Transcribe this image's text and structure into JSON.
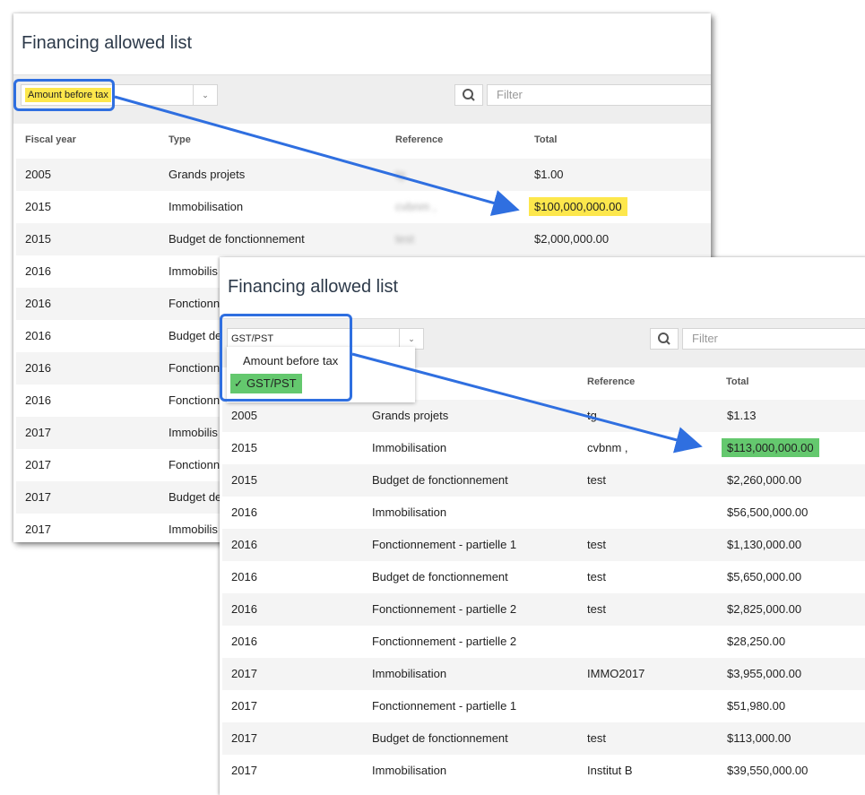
{
  "panel1": {
    "title": "Financing allowed list",
    "select_value": "Amount before tax",
    "filter_placeholder": "Filter",
    "headers": {
      "year": "Fiscal year",
      "type": "Type",
      "reference": "Reference",
      "total": "Total"
    },
    "rows": [
      {
        "year": "2005",
        "type": "Grands projets",
        "reference": "tg",
        "total": "$1.00"
      },
      {
        "year": "2015",
        "type": "Immobilisation",
        "reference": "cvbnm ,",
        "total": "$100,000,000.00"
      },
      {
        "year": "2015",
        "type": "Budget de fonctionnement",
        "reference": "test",
        "total": "$2,000,000.00"
      },
      {
        "year": "2016",
        "type": "Immobilis",
        "reference": "",
        "total": ""
      },
      {
        "year": "2016",
        "type": "Fonctionnem",
        "reference": "",
        "total": ""
      },
      {
        "year": "2016",
        "type": "Budget de",
        "reference": "",
        "total": ""
      },
      {
        "year": "2016",
        "type": "Fonctionnem",
        "reference": "",
        "total": ""
      },
      {
        "year": "2016",
        "type": "Fonctionnem",
        "reference": "",
        "total": ""
      },
      {
        "year": "2017",
        "type": "Immobilis",
        "reference": "",
        "total": ""
      },
      {
        "year": "2017",
        "type": "Fonctionnem",
        "reference": "",
        "total": ""
      },
      {
        "year": "2017",
        "type": "Budget de",
        "reference": "",
        "total": ""
      },
      {
        "year": "2017",
        "type": "Immobilis",
        "reference": "",
        "total": ""
      }
    ]
  },
  "panel2": {
    "title": "Financing allowed list",
    "select_value": "GST/PST",
    "filter_placeholder": "Filter",
    "dropdown_options": [
      "Amount before tax",
      "GST/PST"
    ],
    "selected_check": "✓",
    "headers": {
      "reference": "Reference",
      "total": "Total"
    },
    "rows": [
      {
        "year": "2005",
        "type": "Grands projets",
        "reference": "tg",
        "total": "$1.13"
      },
      {
        "year": "2015",
        "type": "Immobilisation",
        "reference": "cvbnm ,",
        "total": "$113,000,000.00"
      },
      {
        "year": "2015",
        "type": "Budget de fonctionnement",
        "reference": "test",
        "total": "$2,260,000.00"
      },
      {
        "year": "2016",
        "type": "Immobilisation",
        "reference": "",
        "total": "$56,500,000.00"
      },
      {
        "year": "2016",
        "type": "Fonctionnement - partielle 1",
        "reference": "test",
        "total": "$1,130,000.00"
      },
      {
        "year": "2016",
        "type": "Budget de fonctionnement",
        "reference": "test",
        "total": "$5,650,000.00"
      },
      {
        "year": "2016",
        "type": "Fonctionnement - partielle 2",
        "reference": "test",
        "total": "$2,825,000.00"
      },
      {
        "year": "2016",
        "type": "Fonctionnement - partielle 2",
        "reference": "",
        "total": "$28,250.00"
      },
      {
        "year": "2017",
        "type": "Immobilisation",
        "reference": "IMMO2017",
        "total": "$3,955,000.00"
      },
      {
        "year": "2017",
        "type": "Fonctionnement - partielle 1",
        "reference": "",
        "total": "$51,980.00"
      },
      {
        "year": "2017",
        "type": "Budget de fonctionnement",
        "reference": "test",
        "total": "$113,000.00"
      },
      {
        "year": "2017",
        "type": "Immobilisation",
        "reference": "Institut B",
        "total": "$39,550,000.00"
      }
    ]
  },
  "colors": {
    "callout": "#2f6fe0",
    "highlight_yellow": "#fde74c",
    "highlight_green": "#64c86e"
  }
}
